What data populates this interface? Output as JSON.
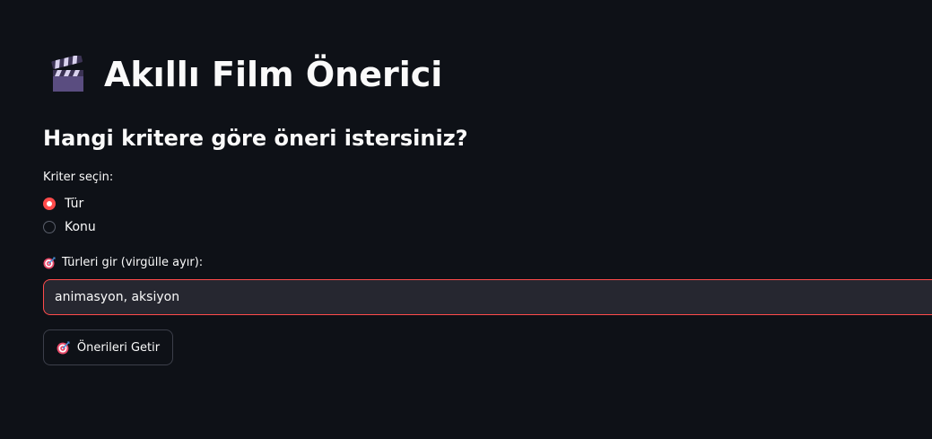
{
  "header": {
    "title": "Akıllı Film Önerici",
    "title_icon": "clapper-board-icon"
  },
  "criteria": {
    "heading": "Hangi kritere göre öneri istersiniz?",
    "radio_label": "Kriter seçin:",
    "options": [
      {
        "label": "Tür",
        "selected": true
      },
      {
        "label": "Konu",
        "selected": false
      }
    ]
  },
  "genre_input": {
    "label": "Türleri gir (virgülle ayır):",
    "label_icon": "dart-target-icon",
    "value": "animasyon, aksiyon"
  },
  "submit": {
    "label": "Önerileri Getir",
    "icon": "dart-target-icon"
  },
  "colors": {
    "background": "#0e1117",
    "accent": "#ff4b4b",
    "input_bg": "#262730",
    "text": "#fafafa"
  }
}
